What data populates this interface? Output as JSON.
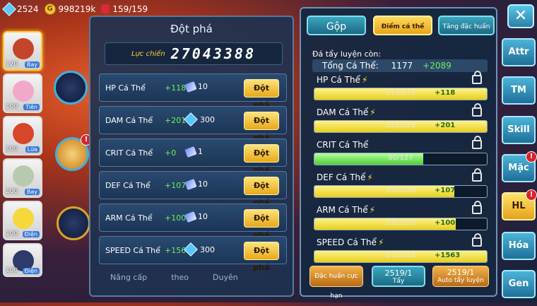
{
  "topbar": {
    "gems": "2524",
    "gold": "998219k",
    "stamina": "159/159"
  },
  "team": [
    {
      "level": "120",
      "tag": "Bay",
      "color": "#c4452a"
    },
    {
      "level": "100",
      "tag": "Tiên",
      "color": "#f2a8c8"
    },
    {
      "level": "100",
      "tag": "Lửa",
      "color": "#d8462a"
    },
    {
      "level": "100",
      "tag": "Bay",
      "color": "#b9c8b0"
    },
    {
      "level": "100",
      "tag": "Điện",
      "color": "#f6d83a"
    },
    {
      "level": "100",
      "tag": "Điện",
      "color": "#2e3a6a"
    }
  ],
  "break_panel": {
    "title": "Đột phá",
    "power_label": "Lực chiến",
    "power_value": "27043388",
    "rows": [
      {
        "name": "HP Cá Thể",
        "bonus": "+118",
        "cost": "10",
        "cost_type": "scroll",
        "button": "Đột phá"
      },
      {
        "name": "DAM Cá Thể",
        "bonus": "+201",
        "cost": "300",
        "cost_type": "gem",
        "button": "Đột phá"
      },
      {
        "name": "CRIT Cá Thể",
        "bonus": "+0",
        "cost": "1",
        "cost_type": "scroll",
        "button": "Đột phá"
      },
      {
        "name": "DEF Cá Thể",
        "bonus": "+107",
        "cost": "10",
        "cost_type": "scroll",
        "button": "Đột phá"
      },
      {
        "name": "ARM Cá Thể",
        "bonus": "+100",
        "cost": "10",
        "cost_type": "scroll",
        "button": "Đột phá"
      },
      {
        "name": "SPEED Cá Thể",
        "bonus": "+1563",
        "cost": "300",
        "cost_type": "gem",
        "button": "Đột phá"
      }
    ],
    "bottom_tabs": [
      "Nâng cấp",
      "theo",
      "Duyên"
    ]
  },
  "train_panel": {
    "tabs": [
      "Gộp",
      "Điểm cá thể",
      "Tăng đặc huấn"
    ],
    "remain_label": "Đá tẩy luyện còn:",
    "total_label": "Tổng Cá Thể:",
    "total_value": "1177",
    "total_bonus": "+2089",
    "stats": [
      {
        "name": "HP Cá Thể",
        "value": "273/273",
        "bonus": "+118",
        "fill": 1.0,
        "bolt": true,
        "color": "yellow"
      },
      {
        "name": "DAM Cá Thể",
        "value": "225/225",
        "bonus": "+201",
        "fill": 1.0,
        "bolt": true,
        "color": "yellow"
      },
      {
        "name": "CRIT Cá Thể",
        "value": "80/127",
        "bonus": "",
        "fill": 0.63,
        "bolt": false,
        "color": "green"
      },
      {
        "name": "DEF Cá Thể",
        "value": "192/236",
        "bonus": "+107",
        "fill": 0.81,
        "bolt": true,
        "color": "yellow"
      },
      {
        "name": "ARM Cá Thể",
        "value": "191/233",
        "bonus": "+100",
        "fill": 0.82,
        "bolt": true,
        "color": "yellow"
      },
      {
        "name": "SPEED Cá Thể",
        "value": "212/212",
        "bonus": "+1563",
        "fill": 1.0,
        "bolt": true,
        "color": "yellow"
      }
    ],
    "actions": {
      "special_train": "Đặc huấn cực hạn",
      "wash_count": "2519/1",
      "wash_label": "Tẩy",
      "auto_count": "2519/1",
      "auto_label": "Auto tẩy luyện"
    }
  },
  "close_label": "✕",
  "right_tabs": [
    {
      "label": "Attr",
      "active": false,
      "badge": false
    },
    {
      "label": "TM",
      "active": false,
      "badge": false
    },
    {
      "label": "Skill",
      "active": false,
      "badge": false
    },
    {
      "label": "Mặc",
      "active": false,
      "badge": true
    },
    {
      "label": "HL",
      "active": true,
      "badge": true
    },
    {
      "label": "Hóa",
      "active": false,
      "badge": false
    },
    {
      "label": "Gen",
      "active": false,
      "badge": false
    }
  ]
}
